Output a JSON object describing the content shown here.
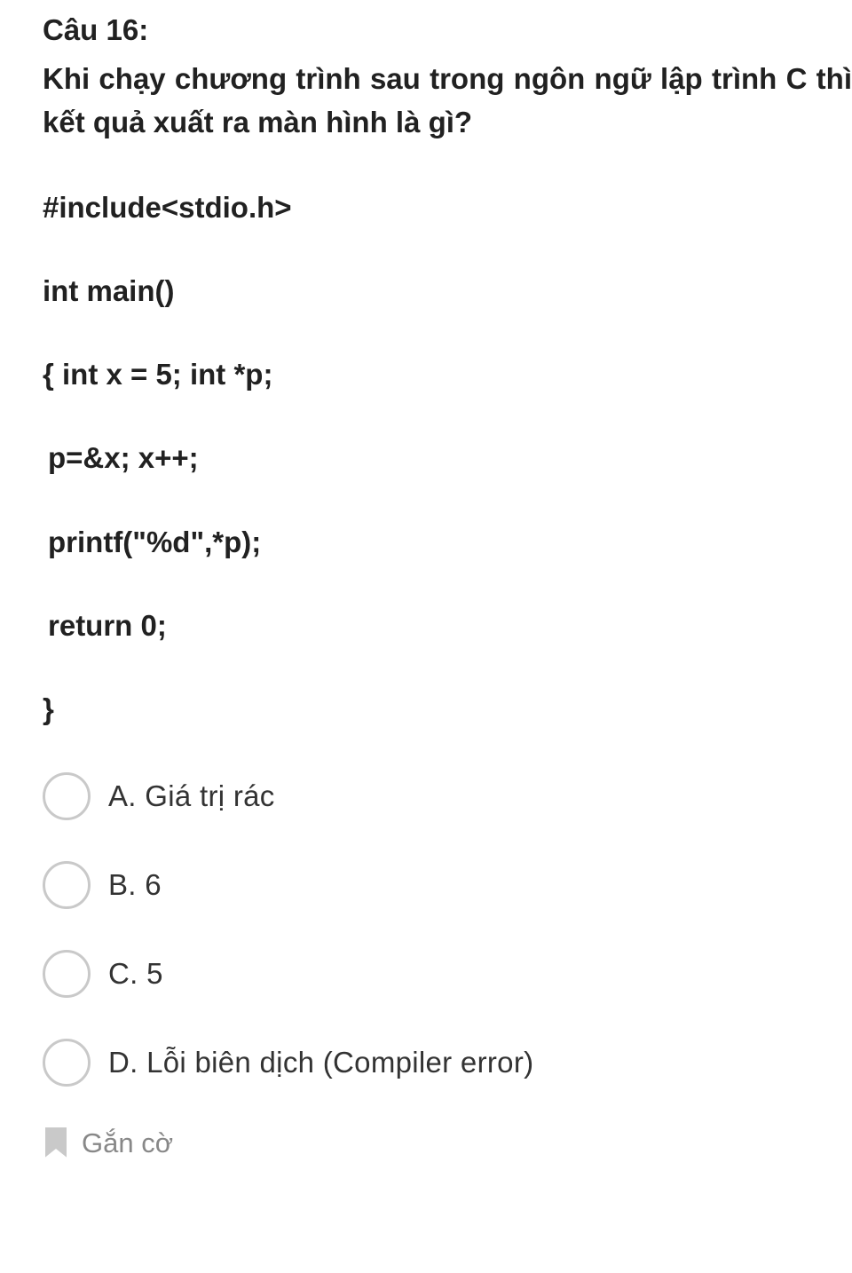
{
  "question": {
    "number_label": "Câu 16:",
    "prompt": "Khi chạy chương trình sau trong ngôn ngữ lập trình C thì kết quả xuất ra màn hình là gì?"
  },
  "code": {
    "line1": "#include<stdio.h>",
    "line2": "int main()",
    "line3": "{ int x = 5; int *p;",
    "line4": "p=&x; x++;",
    "line5": "printf(\"%d\",*p);",
    "line6": "return 0;",
    "line7": "}"
  },
  "options": {
    "a": "A. Giá trị rác",
    "b": "B. 6",
    "c": "C. 5",
    "d": "D. Lỗi biên dịch (Compiler error)"
  },
  "flag": {
    "label": "Gắn cờ"
  }
}
